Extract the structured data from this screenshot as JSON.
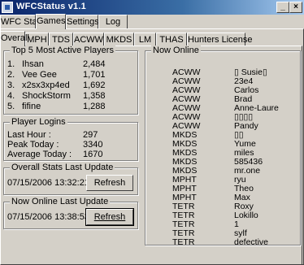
{
  "window": {
    "title": "WFCStatus v1.1"
  },
  "main_tabs": [
    {
      "label": "WFC Status"
    },
    {
      "label": "Games",
      "active": true
    },
    {
      "label": "Settings"
    },
    {
      "label": "Log"
    }
  ],
  "game_tabs": [
    {
      "label": "Overall",
      "active": true
    },
    {
      "label": "MPH"
    },
    {
      "label": "TDS"
    },
    {
      "label": "ACWW"
    },
    {
      "label": "MKDS"
    },
    {
      "label": "LM"
    },
    {
      "label": "THAS"
    },
    {
      "label": "Hunters License"
    }
  ],
  "top5": {
    "title": "Top 5 Most Active Players",
    "players": [
      {
        "rank": "1.",
        "name": "Ihsan",
        "count": "2,484"
      },
      {
        "rank": "2.",
        "name": "Vee Gee",
        "count": "1,701"
      },
      {
        "rank": "3.",
        "name": "x2sx3xp4ed",
        "count": "1,692"
      },
      {
        "rank": "4.",
        "name": "ShockStorm",
        "count": "1,358"
      },
      {
        "rank": "5.",
        "name": "fifine",
        "count": "1,288"
      }
    ]
  },
  "logins": {
    "title": "Player Logins",
    "rows": [
      {
        "label": "Last Hour :",
        "value": "297"
      },
      {
        "label": "Peak Today :",
        "value": "3340"
      },
      {
        "label": "Average Today :",
        "value": "1670"
      }
    ]
  },
  "overall_update": {
    "title": "Overall Stats Last Update",
    "timestamp": "07/15/2006 13:32:21",
    "button": "Refresh"
  },
  "online_update": {
    "title": "Now Online Last Update",
    "timestamp": "07/15/2006 13:38:53",
    "button": "Refresh"
  },
  "now_online": {
    "title": "Now Online",
    "entries": [
      {
        "game": "ACWW",
        "name": "▯ Susie▯"
      },
      {
        "game": "ACWW",
        "name": "23e4"
      },
      {
        "game": "ACWW",
        "name": "Carlos"
      },
      {
        "game": "ACWW",
        "name": "Brad"
      },
      {
        "game": "ACWW",
        "name": "Anne-Laure"
      },
      {
        "game": "ACWW",
        "name": "▯▯▯▯"
      },
      {
        "game": "ACWW",
        "name": "Pandy"
      },
      {
        "game": "MKDS",
        "name": "▯▯"
      },
      {
        "game": "MKDS",
        "name": "Yume"
      },
      {
        "game": "MKDS",
        "name": "miles"
      },
      {
        "game": "MKDS",
        "name": "585436"
      },
      {
        "game": "MKDS",
        "name": "mr.one"
      },
      {
        "game": "MPHT",
        "name": "ryu"
      },
      {
        "game": "MPHT",
        "name": "Theo"
      },
      {
        "game": "MPHT",
        "name": "Max"
      },
      {
        "game": "TETR",
        "name": "Roxy"
      },
      {
        "game": "TETR",
        "name": "Lokillo"
      },
      {
        "game": "TETR",
        "name": "1"
      },
      {
        "game": "TETR",
        "name": "sylf"
      },
      {
        "game": "TETR",
        "name": "defective"
      }
    ]
  }
}
